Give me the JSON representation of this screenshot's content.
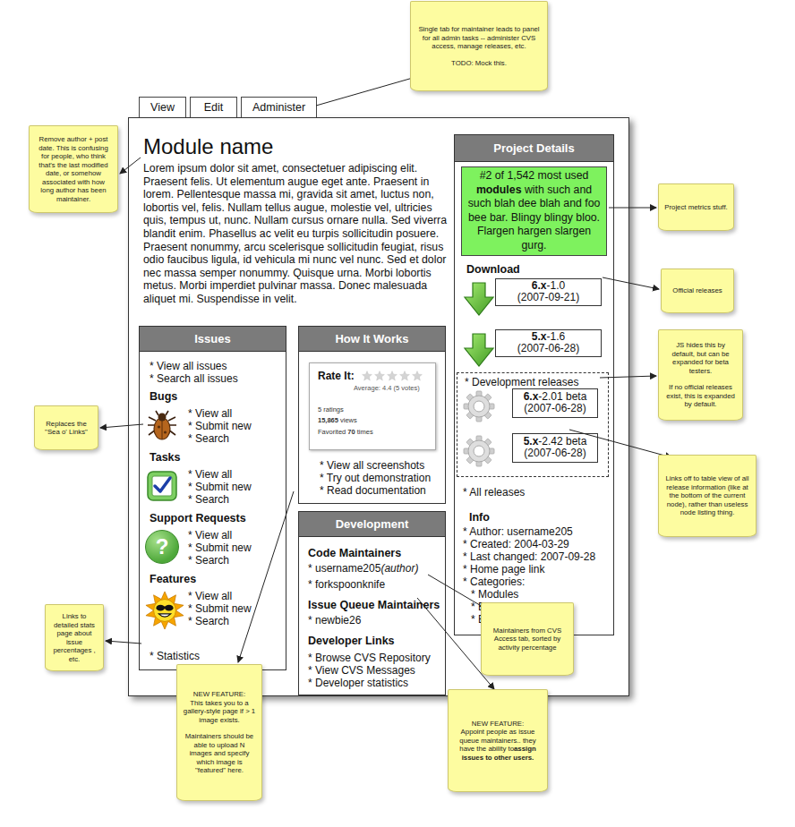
{
  "tabs": [
    {
      "label": "View"
    },
    {
      "label": "Edit"
    },
    {
      "label": "Administer"
    }
  ],
  "module": {
    "title": "Module name",
    "description": "Lorem ipsum dolor sit amet, consectetuer adipiscing elit. Praesent felis. Ut elementum augue eget ante. Praesent in lorem. Pellentesque massa mi, gravida sit amet, luctus non, lobortis vel, felis. Nullam tellus augue, molestie vel, ultricies quis, tempus ut, nunc. Nullam cursus ornare nulla. Sed viverra blandit enim. Phasellus ac velit eu turpis sollicitudin posuere. Praesent nonummy, arcu scelerisque sollicitudin feugiat, risus odio faucibus ligula, id vehicula mi nunc vel nunc. Sed et dolor nec massa semper nonummy. Quisque urna. Morbi lobortis metus. Morbi imperdiet pulvinar massa. Donec malesuada aliquet mi. Suspendisse in velit."
  },
  "issues": {
    "title": "Issues",
    "links": [
      "* View all issues",
      "* Search all issues"
    ],
    "groups": [
      {
        "name": "Bugs",
        "kind": "bug",
        "links": [
          "* View all",
          "* Submit new",
          "* Search"
        ]
      },
      {
        "name": "Tasks",
        "kind": "task",
        "links": [
          "* View all",
          "* Submit new",
          "* Search"
        ]
      },
      {
        "name": "Support Requests",
        "kind": "support",
        "glyph": "?",
        "links": [
          "* View all",
          "* Submit new",
          "* Search"
        ]
      },
      {
        "name": "Features",
        "kind": "feature",
        "links": [
          "* View all",
          "* Submit new",
          "* Search"
        ]
      }
    ],
    "footer": "* Statistics"
  },
  "how": {
    "title": "How It Works",
    "rating": {
      "label": "Rate It:",
      "stars": 0,
      "average": "Average: 4.4 (5 votes)",
      "stats": [
        [
          {
            "text": "5 ratings",
            "bold": false
          }
        ],
        [
          {
            "text": "15,865",
            "bold": true
          },
          {
            "text": " views",
            "bold": false
          }
        ],
        [
          {
            "text": "Favorited ",
            "bold": false
          },
          {
            "text": "70",
            "bold": true
          },
          {
            "text": " times",
            "bold": false
          }
        ]
      ]
    },
    "links": [
      "* View all screenshots",
      "* Try out demonstration",
      "* Read documentation"
    ]
  },
  "development": {
    "title": "Development",
    "sections": [
      {
        "title": "Code Maintainers",
        "items": [
          {
            "text": "* username205",
            "note": "(author)"
          },
          {
            "text": "* forkspoonknife"
          }
        ]
      },
      {
        "title": "Issue Queue Maintainers",
        "items": [
          {
            "text": "* newbie26"
          }
        ]
      },
      {
        "title": "Developer Links",
        "items": [
          {
            "text": "* Browse CVS Repository"
          },
          {
            "text": "* View CVS Messages"
          },
          {
            "text": "* Developer statistics"
          }
        ]
      }
    ]
  },
  "details": {
    "title": "Project Details",
    "metrics": [
      {
        "text": "#2 of 1,542 most used ",
        "bold": false
      },
      {
        "text": "modules",
        "bold": true
      },
      {
        "text": " with such and such blah dee blah and foo bee bar. Blingy blingy bloo. Flargen hargen slargen gurg.",
        "bold": false
      }
    ],
    "download": "Download",
    "official": [
      {
        "version": "6.x",
        "rest": "-1.0",
        "date": "(2007-09-21)"
      },
      {
        "version": "5.x",
        "rest": "-1.6",
        "date": "(2007-06-28)"
      }
    ],
    "devToggle": "* Development releases",
    "devExpanded": true,
    "dev": [
      {
        "version": "6.x",
        "rest": "-2.01 beta",
        "date": "(2007-06-28)"
      },
      {
        "version": "5.x",
        "rest": "-2.42 beta",
        "date": "(2007-06-28)"
      }
    ],
    "allReleases": "* All releases",
    "info": {
      "title": "Info",
      "items": [
        "* Author: username205",
        "* Created: 2004-03-29",
        "* Last changed: 2007-09-28",
        "* Home page link",
        "* Categories:"
      ],
      "categories": [
        "* Modules",
        "* Blah",
        "* Blee"
      ]
    }
  },
  "notes": [
    {
      "paragraphs": [
        {
          "lines": [
            "Single tab for maintainer leads to panel for all admin tasks -- administer CVS access, manage releases, etc."
          ]
        },
        {
          "lines": [
            "TODO: Mock this."
          ]
        }
      ]
    },
    {
      "paragraphs": [
        {
          "lines": [
            "Remove author + post date. This is confusing for people, who think that's the last modified date, or somehow associated with how long author has been maintainer."
          ]
        }
      ]
    },
    {
      "paragraphs": [
        {
          "lines": [
            "Project metrics stuff."
          ]
        }
      ]
    },
    {
      "paragraphs": [
        {
          "lines": [
            "Official releases"
          ]
        }
      ]
    },
    {
      "paragraphs": [
        {
          "lines": [
            "JS hides this by default,  but can be expanded for beta testers."
          ]
        },
        {
          "lines": [
            "If no official releases exist, this is expanded by default."
          ]
        }
      ]
    },
    {
      "paragraphs": [
        {
          "lines": [
            "Links off to table view of all release information (like at the bottom of the current node), rather than useless node listing thing."
          ]
        }
      ]
    },
    {
      "paragraphs": [
        {
          "lines": [
            "Replaces the \"Sea o' Links\""
          ]
        }
      ]
    },
    {
      "paragraphs": [
        {
          "lines": [
            "Links to detailed stats page about issue percentages , etc."
          ]
        }
      ]
    },
    {
      "paragraphs": [
        {
          "lines": [
            "NEW FEATURE:",
            "This takes you to a gallery-style page if > 1 image exists."
          ]
        },
        {
          "lines": [
            "Maintainers should be able to upload N images and specify which image is \"featured\" here."
          ]
        }
      ]
    },
    {
      "paragraphs": [
        {
          "lines": [
            "Maintainers from CVS Access tab, sorted by activity percentage"
          ]
        }
      ]
    },
    {
      "paragraphs": [
        {
          "lines": [
            "NEW FEATURE:",
            "Appoint people as issue queue maintainers.. they have the ability to"
          ],
          "bold": "assign issues to other users."
        }
      ]
    }
  ]
}
